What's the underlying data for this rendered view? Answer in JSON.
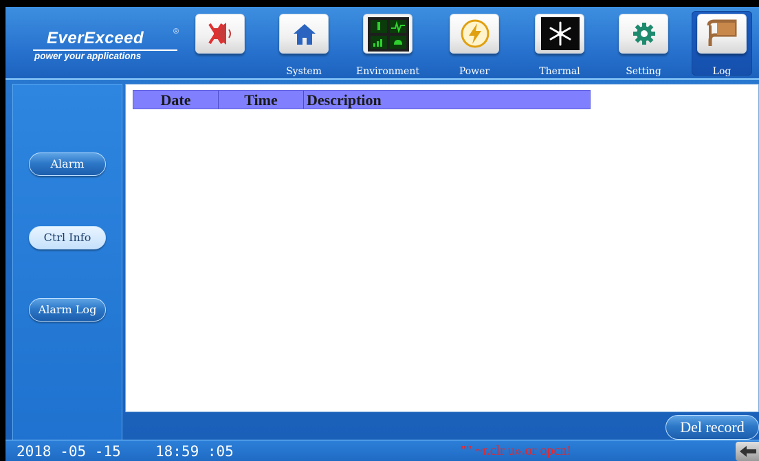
{
  "brand": {
    "name": "EverExceed",
    "registered": "®",
    "tagline": "power your applications"
  },
  "nav": {
    "mute_icon": "speaker-muted-icon",
    "items": [
      {
        "label": "System",
        "icon": "home-icon"
      },
      {
        "label": "Environment",
        "icon": "environment-dashboard-icon"
      },
      {
        "label": "Power",
        "icon": "lightning-icon"
      },
      {
        "label": "Thermal",
        "icon": "snowflake-icon"
      },
      {
        "label": "Setting",
        "icon": "gear-icon"
      },
      {
        "label": "Log",
        "icon": "log-flag-icon",
        "active": true
      }
    ]
  },
  "sidebar": {
    "items": [
      {
        "label": "Alarm"
      },
      {
        "label": "Ctrl Info",
        "selected": true
      },
      {
        "label": "Alarm Log"
      }
    ]
  },
  "log_table": {
    "columns": [
      "Date",
      "Time",
      "Description"
    ],
    "rows": []
  },
  "actions": {
    "del_record": "Del record"
  },
  "status": {
    "date": "2018 -05 -15",
    "time": "18:59 :05",
    "warning": "\"\" ~r.clr u».or opcn!"
  },
  "colors": {
    "header_bar": "#2873cf",
    "table_header": "#8080ff",
    "warning": "#e8262b"
  }
}
